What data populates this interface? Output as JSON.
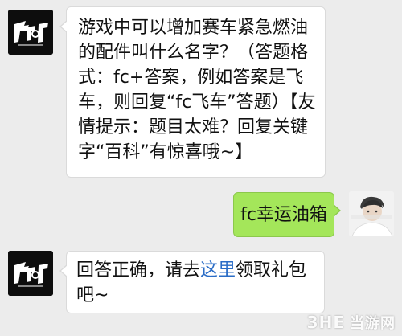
{
  "conversation": {
    "messages": [
      {
        "sender": "game-account",
        "direction": "incoming",
        "lines": [
          "游戏中可以增加赛车紧急燃油",
          "的配件叫什么名字？（答题格",
          "式：fc+答案，例如答案是飞",
          "车，则回复“fc飞车”答题）【友",
          "情提示：题目太难？回复关键",
          "字“百科”有惊喜哦~】"
        ]
      },
      {
        "sender": "user",
        "direction": "outgoing",
        "text": "fc幸运油箱"
      },
      {
        "sender": "game-account",
        "direction": "incoming",
        "line1_before": "回答正确，请去",
        "line1_link": "这里",
        "line1_after": "领取礼包",
        "line2": "吧~"
      }
    ]
  },
  "watermark": {
    "brand": "3HE",
    "site": "当游网"
  },
  "colors": {
    "background": "#ececec",
    "incoming_bubble": "#ffffff",
    "outgoing_bubble": "#a4e65a",
    "link": "#2a6cc6",
    "game_avatar_bg": "#0d0d0d"
  },
  "icons": {
    "game_avatar": "game-logo-avatar",
    "user_avatar": "user-photo-avatar"
  }
}
